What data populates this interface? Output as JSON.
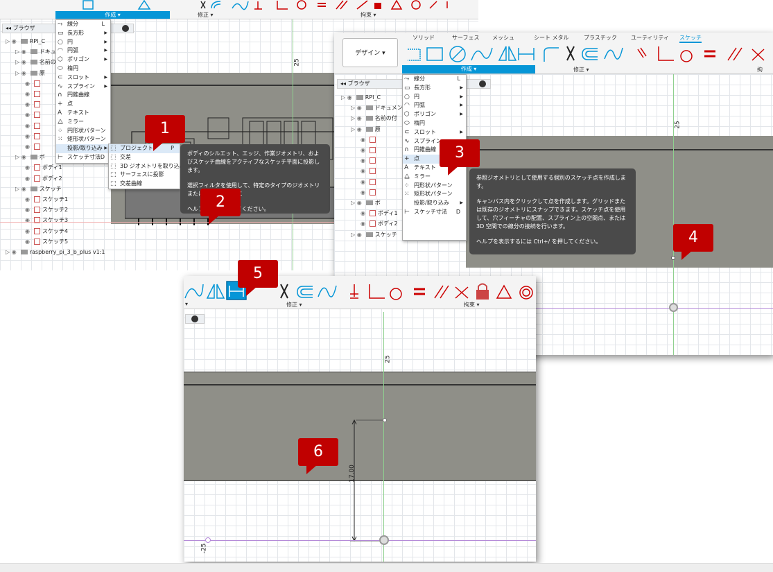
{
  "panel1": {
    "ribbon_groups": [
      "作成 ▾",
      "修正 ▾",
      "拘束 ▾"
    ],
    "browser_label": "ブラウザ",
    "axis_label": "25",
    "menu_items": [
      {
        "icon": "line-icon",
        "glyph": "⤳",
        "label": "線分",
        "key": "L"
      },
      {
        "icon": "rectangle-icon",
        "glyph": "▭",
        "label": "長方形",
        "arrow": "▶"
      },
      {
        "icon": "circle-icon",
        "glyph": "○",
        "label": "円",
        "arrow": "▶"
      },
      {
        "icon": "arc-icon",
        "glyph": "◠",
        "label": "円弧",
        "arrow": "▶"
      },
      {
        "icon": "polygon-icon",
        "glyph": "⬡",
        "label": "ポリゴン",
        "arrow": "▶"
      },
      {
        "icon": "ellipse-icon",
        "glyph": "⬭",
        "label": "楕円"
      },
      {
        "icon": "slot-icon",
        "glyph": "⊂",
        "label": "スロット",
        "arrow": "▶"
      },
      {
        "icon": "spline-icon",
        "glyph": "∿",
        "label": "スプライン",
        "arrow": "▶"
      },
      {
        "icon": "conic-curve-icon",
        "glyph": "∩",
        "label": "円錐曲線"
      },
      {
        "icon": "point-icon",
        "glyph": "+",
        "label": "点"
      },
      {
        "icon": "text-icon",
        "glyph": "A",
        "label": "テキスト"
      },
      {
        "icon": "mirror-icon",
        "glyph": "⧋",
        "label": "ミラー"
      },
      {
        "icon": "circular-pattern-icon",
        "glyph": "⁘",
        "label": "円形状パターン"
      },
      {
        "icon": "rectangular-pattern-icon",
        "glyph": "⁙",
        "label": "矩形状パターン"
      },
      {
        "icon": "project-include-icon",
        "glyph": "",
        "label": "投影/取り込み",
        "arrow": "▶"
      },
      {
        "icon": "sketch-dimension-icon",
        "glyph": "⊢",
        "label": "スケッチ寸法",
        "key": "D"
      }
    ],
    "submenu_items": [
      {
        "icon": "project-icon",
        "glyph": "⬚",
        "label": "プロジェクト",
        "key": "P"
      },
      {
        "icon": "intersect-icon",
        "glyph": "⬚",
        "label": "交差"
      },
      {
        "icon": "include-3d-icon",
        "glyph": "⬚",
        "label": "3D ジオメトリを取り込み"
      },
      {
        "icon": "project-to-surface-icon",
        "glyph": "⬚",
        "label": "サーフェスに投影"
      },
      {
        "icon": "intersection-curve-icon",
        "glyph": "⬚",
        "label": "交差曲線"
      }
    ],
    "tooltip": [
      "ボディのシルエット、エッジ、作業ジオメトリ、およびスケッチ曲線をアクティブなスケッチ平面に投影します。",
      "選択フィルタを使用して、特定のタイプのジオメトリまたはボディのシルエ",
      "ヘルプ     trl+/ を押してください。"
    ],
    "tree": [
      {
        "label": "RPI_C",
        "indent": 0
      },
      {
        "label": "ドキュメン",
        "indent": 1
      },
      {
        "label": "名前の付",
        "indent": 1
      },
      {
        "label": "原",
        "indent": 1
      },
      {
        "label": "",
        "indent": 2
      },
      {
        "label": "",
        "indent": 2
      },
      {
        "label": "",
        "indent": 2
      },
      {
        "label": "",
        "indent": 2
      },
      {
        "label": "",
        "indent": 2
      },
      {
        "label": "",
        "indent": 2
      },
      {
        "label": "",
        "indent": 2
      },
      {
        "label": "ボ",
        "indent": 1
      },
      {
        "label": "ボディ1",
        "indent": 2
      },
      {
        "label": "ボディ2",
        "indent": 2
      },
      {
        "label": "スケッチ",
        "indent": 1
      },
      {
        "label": "スケッチ1",
        "indent": 2
      },
      {
        "label": "スケッチ2",
        "indent": 2
      },
      {
        "label": "スケッチ3",
        "indent": 2
      },
      {
        "label": "スケッチ4",
        "indent": 2
      },
      {
        "label": "スケッチ5",
        "indent": 2
      },
      {
        "label": "raspberry_pi_3_b_plus v1:1",
        "indent": 0
      }
    ]
  },
  "panel2": {
    "design_button": "デザイン ▾",
    "tabs": [
      "ソリッド",
      "サーフェス",
      "メッシュ",
      "シート メタル",
      "プラスチック",
      "ユーティリティ",
      "スケッチ"
    ],
    "active_tab": "スケッチ",
    "ribbon_groups": [
      "作成 ▾",
      "修正 ▾",
      "拘"
    ],
    "browser_label": "ブラウザ",
    "axis_label": "25",
    "menu_items": [
      {
        "icon": "line-icon",
        "glyph": "⤳",
        "label": "線分",
        "key": "L"
      },
      {
        "icon": "rectangle-icon",
        "glyph": "▭",
        "label": "長方形",
        "arrow": "▶"
      },
      {
        "icon": "circle-icon",
        "glyph": "○",
        "label": "円",
        "arrow": "▶"
      },
      {
        "icon": "arc-icon",
        "glyph": "◠",
        "label": "円弧",
        "arrow": "▶"
      },
      {
        "icon": "polygon-icon",
        "glyph": "⬡",
        "label": "ポリゴン",
        "arrow": "▶"
      },
      {
        "icon": "ellipse-icon",
        "glyph": "⬭",
        "label": "楕円"
      },
      {
        "icon": "slot-icon",
        "glyph": "⊂",
        "label": "スロット",
        "arrow": "▶"
      },
      {
        "icon": "spline-icon",
        "glyph": "∿",
        "label": "スプライン",
        "arrow": "▶"
      },
      {
        "icon": "conic-curve-icon",
        "glyph": "∩",
        "label": "円錐曲線"
      },
      {
        "icon": "point-icon",
        "glyph": "+",
        "label": "点"
      },
      {
        "icon": "text-icon",
        "glyph": "A",
        "label": "テキスト"
      },
      {
        "icon": "mirror-icon",
        "glyph": "⧋",
        "label": "ミラー"
      },
      {
        "icon": "circular-pattern-icon",
        "glyph": "⁘",
        "label": "円形状パターン"
      },
      {
        "icon": "rectangular-pattern-icon",
        "glyph": "⁙",
        "label": "矩形状パターン"
      },
      {
        "icon": "project-include-icon",
        "glyph": "",
        "label": "投影/取り込み",
        "arrow": "▶"
      },
      {
        "icon": "sketch-dimension-icon",
        "glyph": "⊢",
        "label": "スケッチ寸法",
        "key": "D"
      }
    ],
    "tooltip": [
      "参照ジオメトリとして使用する個別のスケッチ点を作成します。",
      "キャンバス内をクリックして点を作成します。グリッドまたは既存のジオメトリにスナップできます。スケッチ点を使用して、穴フィーチャの配置、スプライン上の空間点、または 3D 空間での線分の接続を行います。",
      "ヘルプを表示するには Ctrl+/ を押してください。"
    ],
    "tree": [
      {
        "label": "RPI_C",
        "indent": 0
      },
      {
        "label": "ドキュメン",
        "indent": 1
      },
      {
        "label": "名前の付",
        "indent": 1
      },
      {
        "label": "原",
        "indent": 1
      },
      {
        "label": "",
        "indent": 2
      },
      {
        "label": "",
        "indent": 2
      },
      {
        "label": "",
        "indent": 2
      },
      {
        "label": "",
        "indent": 2
      },
      {
        "label": "",
        "indent": 2
      },
      {
        "label": "",
        "indent": 2
      },
      {
        "label": "ボ",
        "indent": 1
      },
      {
        "label": "ボディ1",
        "indent": 2
      },
      {
        "label": "ボディ2",
        "indent": 2
      },
      {
        "label": "スケッチ",
        "indent": 1
      }
    ]
  },
  "panel3": {
    "ribbon_groups": [
      "修正 ▾",
      "拘束 ▾"
    ],
    "axis_label_top": "25",
    "axis_label_bottom": "-25",
    "dimension_value": "17.00"
  },
  "badges": [
    "1",
    "2",
    "3",
    "4",
    "5",
    "6"
  ]
}
